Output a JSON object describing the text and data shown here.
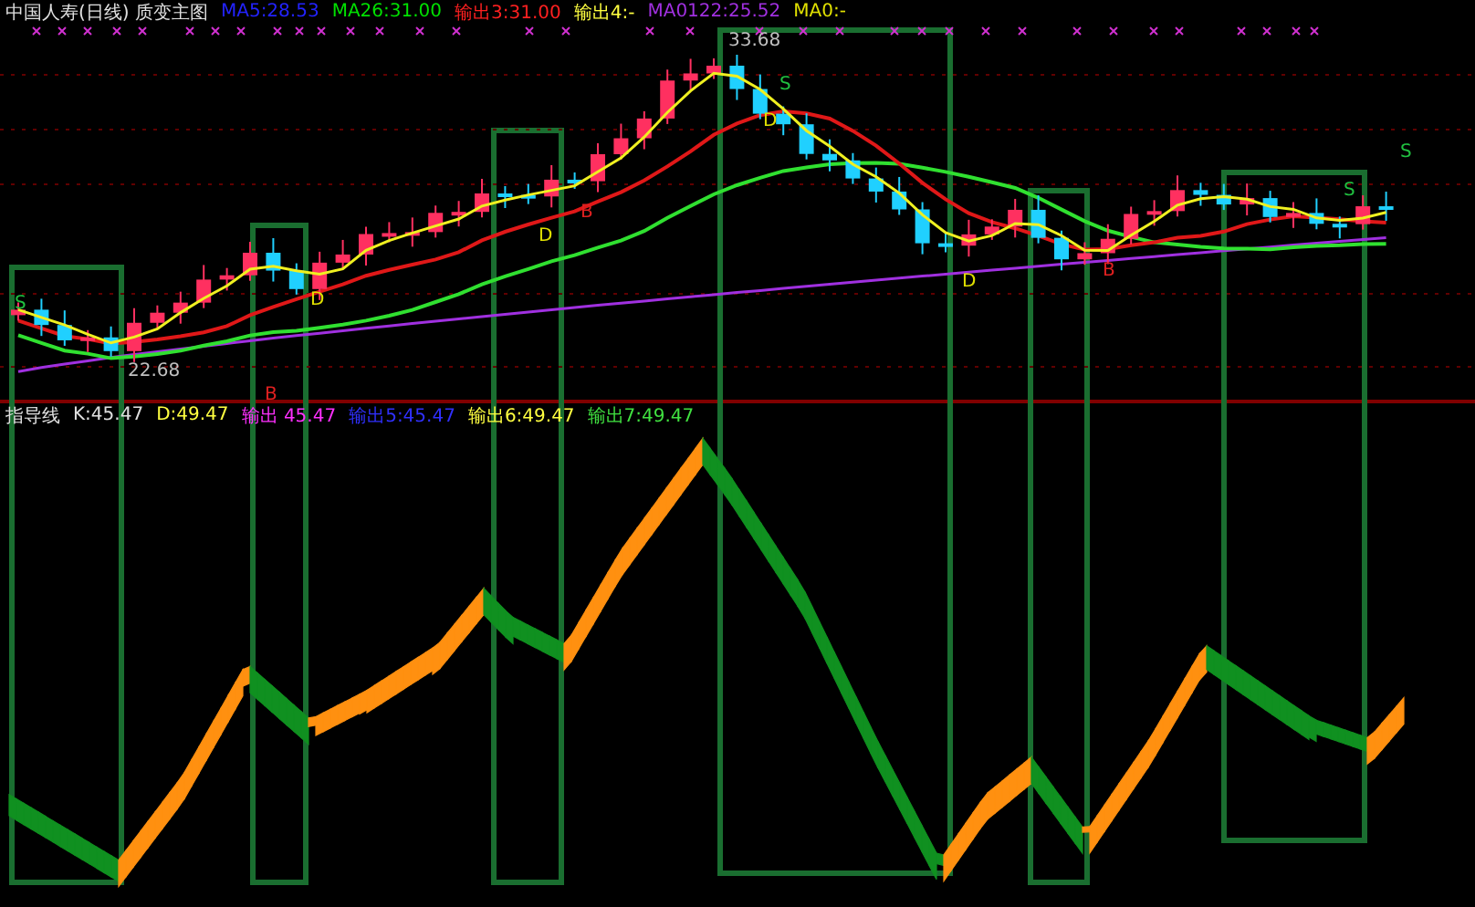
{
  "main_chart": {
    "title": "中国人寿(日线) 质变主图",
    "legend": [
      {
        "text": "MA5:28.53",
        "color": "#2323ff"
      },
      {
        "text": "MA26:31.00",
        "color": "#00e000"
      },
      {
        "text": "输出3:31.00",
        "color": "#ff2020"
      },
      {
        "text": "输出4:-",
        "color": "#ffff40"
      },
      {
        "text": "MA0122:25.52",
        "color": "#a030e0"
      },
      {
        "text": "MA0:-",
        "color": "#e0e000"
      }
    ],
    "price_labels": [
      "33.68",
      "22.68"
    ],
    "signals": [
      {
        "text": "S",
        "kind": "sell"
      },
      {
        "text": "S",
        "kind": "sell"
      },
      {
        "text": "D",
        "kind": "down"
      },
      {
        "text": "D",
        "kind": "down"
      },
      {
        "text": "D",
        "kind": "down"
      },
      {
        "text": "B",
        "kind": "buy"
      },
      {
        "text": "D",
        "kind": "down"
      },
      {
        "text": "B",
        "kind": "buy"
      },
      {
        "text": "S",
        "kind": "sell"
      },
      {
        "text": "S",
        "kind": "sell"
      },
      {
        "text": "B",
        "kind": "buy"
      }
    ]
  },
  "indicator": {
    "title": "指导线",
    "legend": [
      {
        "text": "K:45.47",
        "color": "#e0e0e0"
      },
      {
        "text": "D:49.47",
        "color": "#ffff40"
      },
      {
        "text": "输出 45.47",
        "color": "#ff30ff"
      },
      {
        "text": "输出5:45.47",
        "color": "#3030ff"
      },
      {
        "text": "输出6:49.47",
        "color": "#ffff40"
      },
      {
        "text": "输出7:49.47",
        "color": "#40e040"
      }
    ]
  }
}
